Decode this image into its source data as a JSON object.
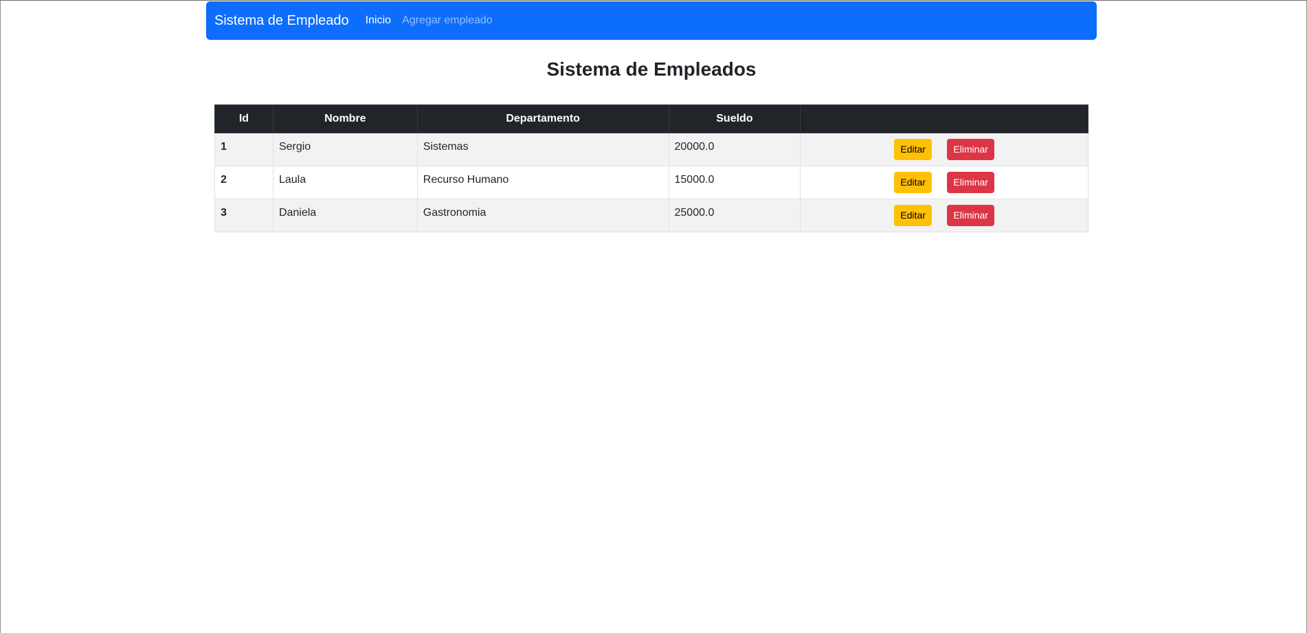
{
  "navbar": {
    "brand": "Sistema de Empleado",
    "links": [
      {
        "label": "Inicio",
        "active": true
      },
      {
        "label": "Agregar empleado",
        "active": false
      }
    ]
  },
  "page_title": "Sistema de Empleados",
  "table": {
    "headers": [
      "Id",
      "Nombre",
      "Departamento",
      "Sueldo",
      ""
    ],
    "rows": [
      {
        "id": "1",
        "nombre": "Sergio",
        "departamento": "Sistemas",
        "sueldo": "20000.0"
      },
      {
        "id": "2",
        "nombre": "Laula",
        "departamento": "Recurso Humano",
        "sueldo": "15000.0"
      },
      {
        "id": "3",
        "nombre": "Daniela",
        "departamento": "Gastronomia",
        "sueldo": "25000.0"
      }
    ],
    "edit_label": "Editar",
    "delete_label": "Eliminar"
  },
  "colors": {
    "navbar_bg": "#0d6efd",
    "header_bg": "#212529",
    "edit_button": "#ffc107",
    "delete_button": "#dc3545"
  }
}
